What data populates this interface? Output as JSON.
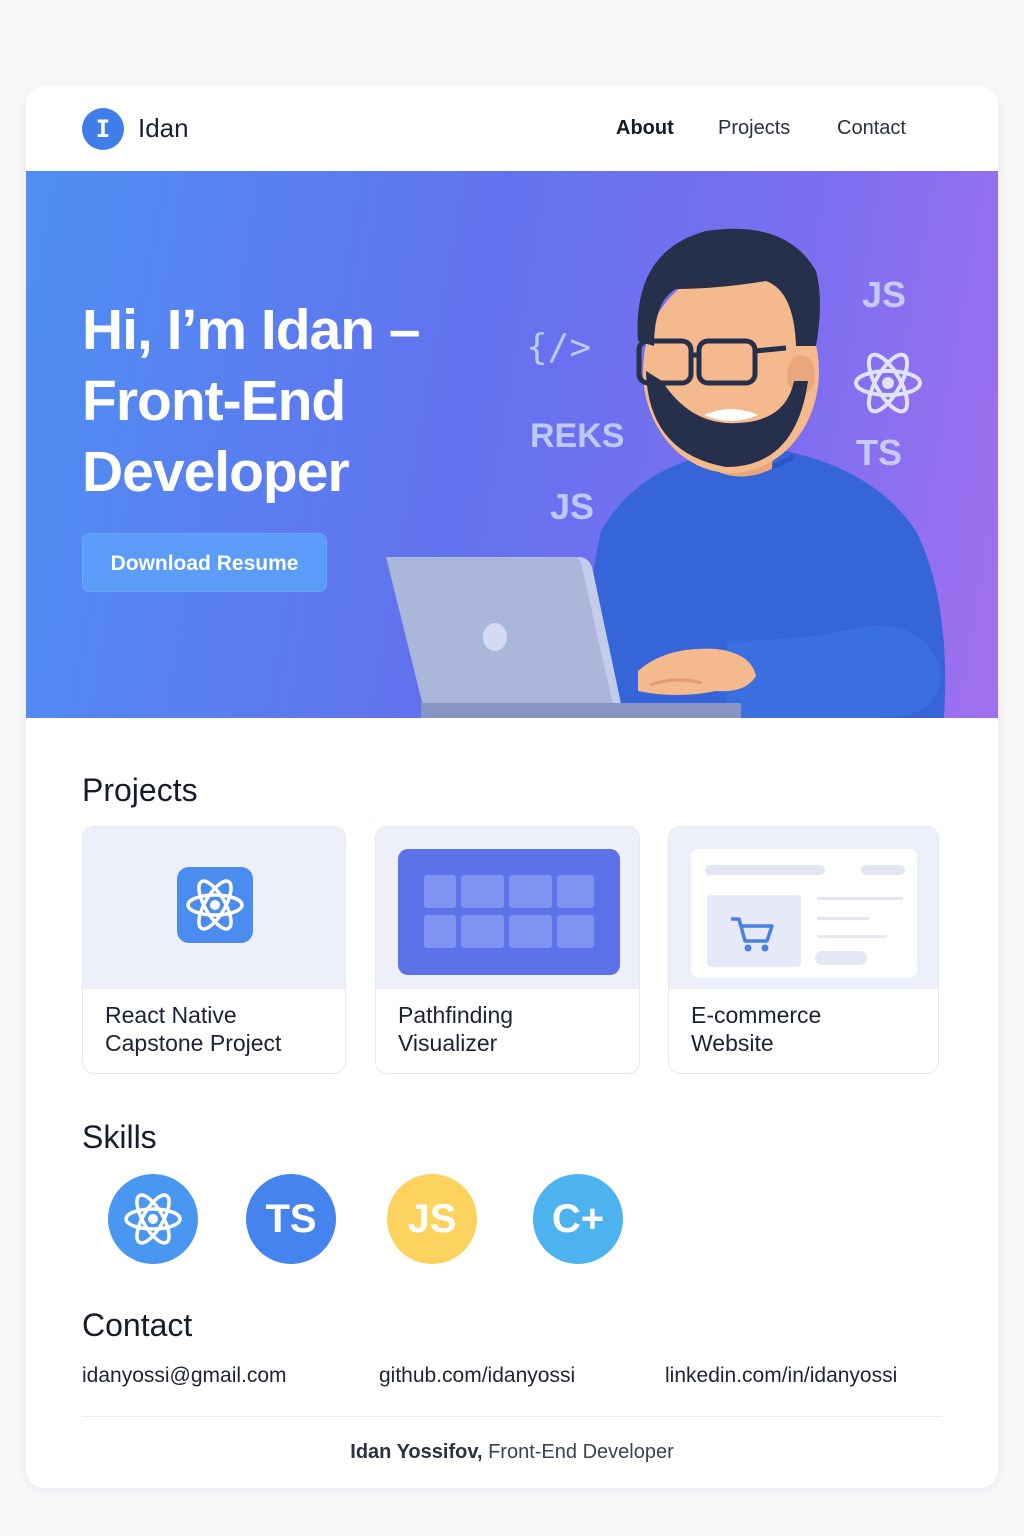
{
  "header": {
    "logo_letter": "I",
    "brand": "Idan",
    "nav": [
      {
        "label": "About",
        "active": true
      },
      {
        "label": "Projects",
        "active": false
      },
      {
        "label": "Contact",
        "active": false
      }
    ]
  },
  "hero": {
    "title_lines": [
      "Hi, I’m Idan –",
      "Front-End",
      "Developer"
    ],
    "button_label": "Download Resume",
    "floating_tags": [
      "{/>",
      "REKS",
      "JS",
      "JS",
      "TS"
    ]
  },
  "projects": {
    "heading": "Projects",
    "items": [
      {
        "title_lines": [
          "React Native",
          "Capstone Project"
        ],
        "icon": "react-icon"
      },
      {
        "title_lines": [
          "Pathfinding",
          "Visualizer"
        ],
        "icon": "grid-icon"
      },
      {
        "title_lines": [
          "E-commerce",
          "Website"
        ],
        "icon": "cart-icon"
      }
    ]
  },
  "skills": {
    "heading": "Skills",
    "items": [
      {
        "label": "",
        "icon": "react-icon",
        "color": "#4a97f1"
      },
      {
        "label": "TS",
        "icon": "typescript-icon",
        "color": "#4584ee"
      },
      {
        "label": "JS",
        "icon": "javascript-icon",
        "color": "#fcd35e"
      },
      {
        "label": "C+",
        "icon": "cpp-icon",
        "color": "#4db3f0"
      }
    ]
  },
  "contact": {
    "heading": "Contact",
    "email": "idanyossi@gmail.com",
    "github": "github.com/idanyossi",
    "linkedin": "linkedin.com/in/idanyossi"
  },
  "footer": {
    "name": "Idan Yossifov,",
    "role": " Front-End Developer"
  },
  "colors": {
    "accent": "#3f7ee8",
    "hero_gradient_start": "#4f8ff3",
    "hero_gradient_end": "#a170ee"
  }
}
